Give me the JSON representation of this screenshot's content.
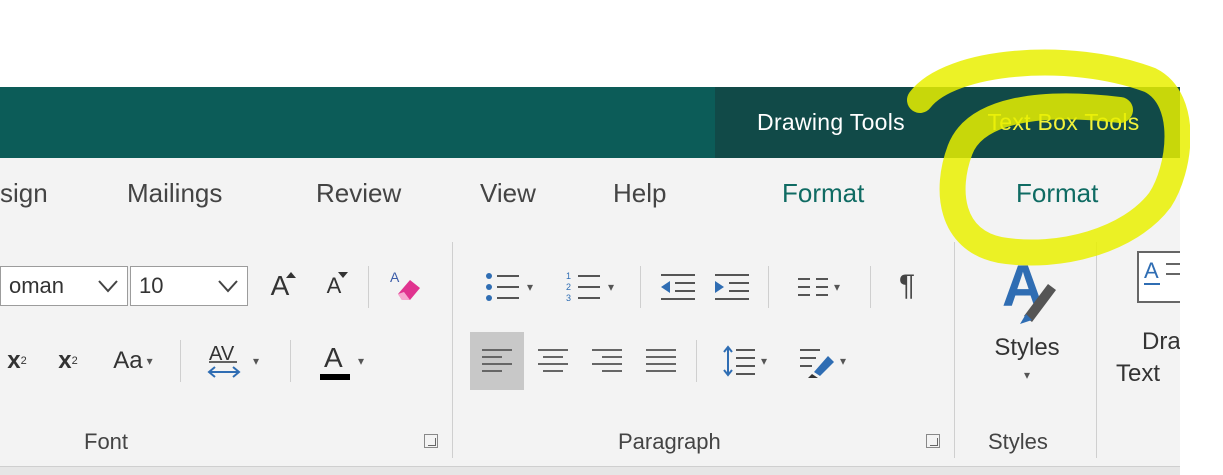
{
  "context_tabs": {
    "drawing_tools": "Drawing Tools",
    "text_box_tools": "Text Box Tools"
  },
  "tabs": {
    "design": "sign",
    "mailings": "Mailings",
    "review": "Review",
    "view": "View",
    "help": "Help",
    "format_drawing": "Format",
    "format_textbox": "Format"
  },
  "font": {
    "name_value": "oman",
    "size_value": "10",
    "grow_label": "A",
    "shrink_label": "A",
    "subscript_label": "x",
    "subscript_sub": "2",
    "superscript_label": "x",
    "superscript_sup": "2",
    "change_case_label": "Aa",
    "spacing_label": "AV",
    "font_color_label": "A",
    "group_label": "Font"
  },
  "paragraph": {
    "group_label": "Paragraph",
    "pilcrow": "¶"
  },
  "styles": {
    "button_label": "Styles",
    "group_label": "Styles"
  },
  "draw_text": {
    "line1": "Dra",
    "line2": "Text"
  },
  "colors": {
    "title_bar": "#0c5c58",
    "context_group": "#114a48",
    "text_box_tools": "#f2f23a",
    "context_tab_text": "#0f6b63",
    "highlighter": "#e9f000"
  }
}
